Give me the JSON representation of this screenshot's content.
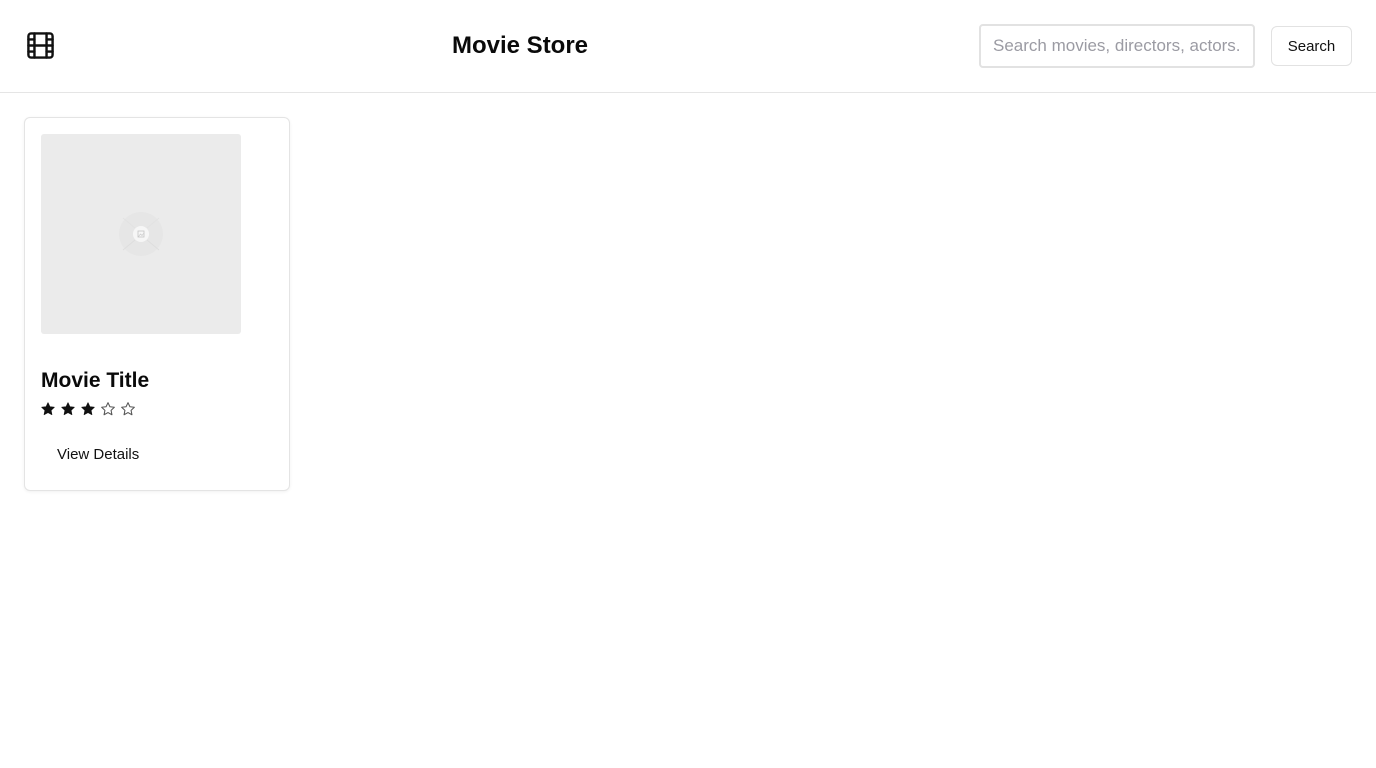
{
  "header": {
    "logo_icon": "film-icon",
    "title": "Movie Store",
    "search_placeholder": "Search movies, directors, actors...",
    "search_value": "",
    "search_button_label": "Search"
  },
  "movies": [
    {
      "poster_icon": "image-placeholder-icon",
      "title": "Movie Title",
      "rating": 3,
      "rating_max": 5,
      "details_button_label": "View Details"
    }
  ],
  "colors": {
    "text": "#111111",
    "border": "#e4e4e4",
    "poster_placeholder": "#ebebeb",
    "placeholder_text": "#9b9ba3"
  }
}
